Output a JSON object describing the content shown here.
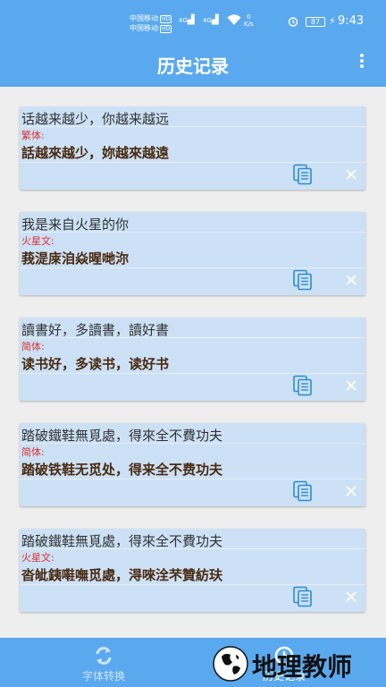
{
  "status_bar": {
    "carrier1": "中国移动",
    "carrier2": "中国移动",
    "hd1": "HD",
    "hd2": "HD",
    "net1": "4G",
    "net2": "4G",
    "speed_value": "0",
    "speed_unit": "K/s",
    "battery": "87",
    "time": "9:43"
  },
  "app_bar": {
    "title": "历史记录",
    "menu_icon": "more-vertical-icon"
  },
  "history": [
    {
      "source": "话越来越少，你越来越远",
      "label": "繁体:",
      "result": "話越來越少，妳越來越遠"
    },
    {
      "source": "我是来自火星的你",
      "label": "火星文:",
      "result": "莪湜庲洎焱暒哋沵"
    },
    {
      "source": "讀書好，多讀書，讀好書",
      "label": "简体:",
      "result": "读书好，多读书，读好书"
    },
    {
      "source": "踏破鐵鞋無覓處，得來全不費功夫",
      "label": "简体:",
      "result": "踏破铁鞋无觅处，得来全不费功夫"
    },
    {
      "source": "踏破鐵鞋無覓處，得來全不費功夫",
      "label": "火星文:",
      "result": "沓皉銕嚡嘸觅處，淂唻洤芣贊紡玞"
    }
  ],
  "bottom_nav": {
    "convert_label": "字体转换",
    "history_label": "历史记录"
  },
  "watermark": {
    "text": "地理教师"
  },
  "colors": {
    "primary": "#5aa9ee",
    "card": "#cce1f5",
    "label_red": "#e03030",
    "result_brown": "#4a2a10",
    "icon_blue": "#2b8ccf"
  }
}
